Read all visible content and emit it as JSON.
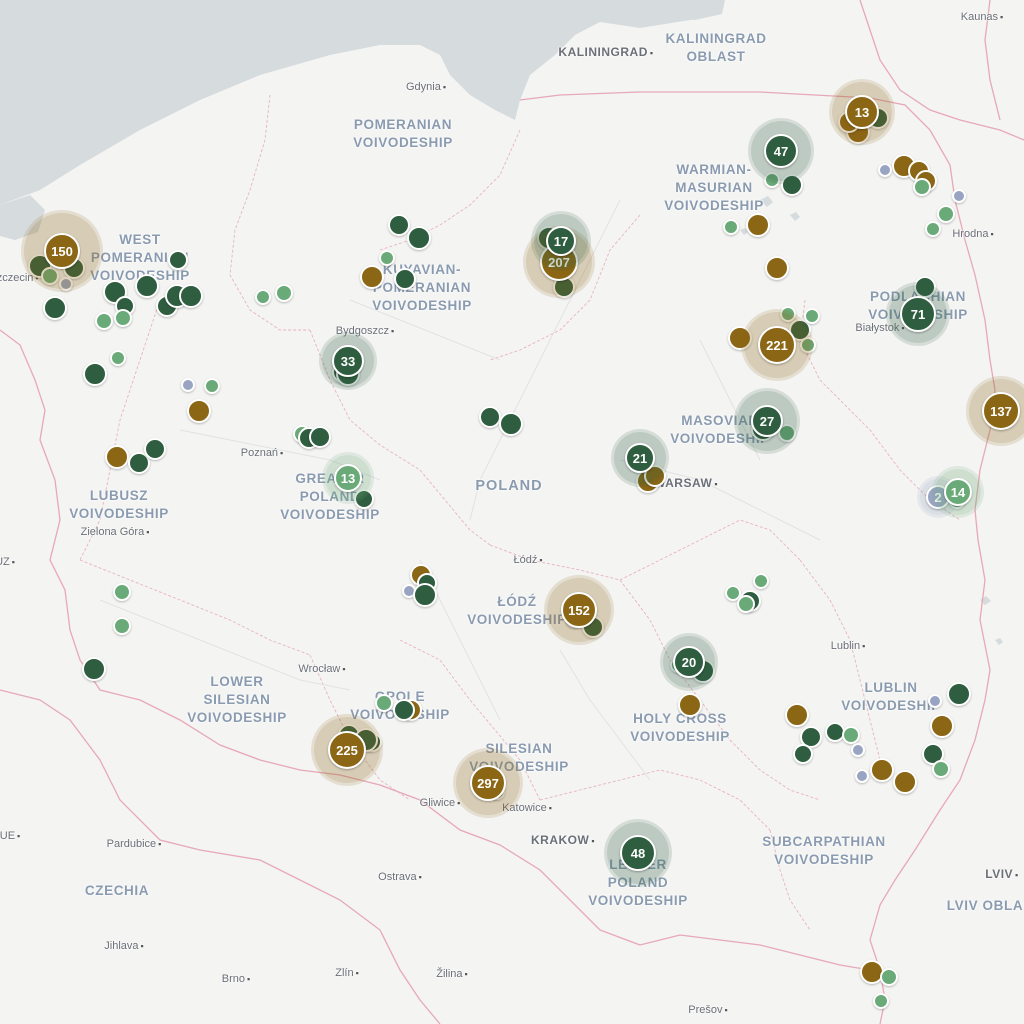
{
  "map": {
    "country_label": "POLAND",
    "colors": {
      "dark_green": "#2f5d3f",
      "light_green": "#6aaa78",
      "brown": "#8b6614",
      "grey_blue": "#98a4c2",
      "water": "#d6dbde",
      "land": "#f4f4f3"
    },
    "region_labels": [
      {
        "text": "KALININGRAD\nOBLAST"
      },
      {
        "text": "POMERANIAN\nVOIVODESHIP"
      },
      {
        "text": "WARMIAN-\nMASURIAN\nVOIVODESHIP"
      },
      {
        "text": "WEST\nPOMERANIAN\nVOIVODESHIP"
      },
      {
        "text": "KUYAVIAN-\nPOMERANIAN\nVOIVODESHIP"
      },
      {
        "text": "PODLACHIAN\nVOIVODESHIP"
      },
      {
        "text": "MASOVIAN\nVOIVODESHIP"
      },
      {
        "text": "GREATER\nPOLAND\nVOIVODESHIP"
      },
      {
        "text": "LUBUSZ\nVOIVODESHIP"
      },
      {
        "text": "ŁÓDŹ\nVOIVODESHIP"
      },
      {
        "text": "LOWER\nSILESIAN\nVOIVODESHIP"
      },
      {
        "text": "OPOLE\nVOIVODESHIP"
      },
      {
        "text": "SILESIAN\nVOIVODESHIP"
      },
      {
        "text": "HOLY CROSS\nVOIVODESHIP"
      },
      {
        "text": "LUBLIN\nVOIVODESHIP"
      },
      {
        "text": "LESSER\nPOLAND\nVOIVODESHIP"
      },
      {
        "text": "SUBCARPATHIAN\nVOIVODESHIP"
      },
      {
        "text": "CZECHIA"
      },
      {
        "text": "LVIV OBLA"
      }
    ],
    "city_labels": [
      {
        "text": "Kaunas"
      },
      {
        "text": "KALININGRAD"
      },
      {
        "text": "Gdynia"
      },
      {
        "text": "Hrodna"
      },
      {
        "text": "Białystok"
      },
      {
        "text": "Bydgoszcz"
      },
      {
        "text": "Poznań"
      },
      {
        "text": "WARSAW"
      },
      {
        "text": "Zielona Góra"
      },
      {
        "text": "Łódź"
      },
      {
        "text": "Lublin"
      },
      {
        "text": "Wrocław"
      },
      {
        "text": "Gliwice"
      },
      {
        "text": "Katowice"
      },
      {
        "text": "KRAKOW"
      },
      {
        "text": "Pardubice"
      },
      {
        "text": "Ostrava"
      },
      {
        "text": "Jihlava"
      },
      {
        "text": "Brno"
      },
      {
        "text": "Zlín"
      },
      {
        "text": "Žilina"
      },
      {
        "text": "Prešov"
      },
      {
        "text": "LVIV"
      },
      {
        "text": "Szczecin"
      },
      {
        "text": "UE"
      },
      {
        "text": "UZ"
      }
    ],
    "clusters": [
      {
        "count": "150",
        "color": "brown"
      },
      {
        "count": "207",
        "color": "brown"
      },
      {
        "count": "47",
        "color": "dark_green"
      },
      {
        "count": "221",
        "color": "brown"
      },
      {
        "count": "71",
        "color": "dark_green"
      },
      {
        "count": "137",
        "color": "brown"
      },
      {
        "count": "21",
        "color": "dark_green"
      },
      {
        "count": "13",
        "color": "light_green"
      },
      {
        "count": "2",
        "color": "grey_blue"
      },
      {
        "count": "152",
        "color": "brown"
      },
      {
        "count": "225",
        "color": "brown"
      },
      {
        "count": "297",
        "color": "brown"
      },
      {
        "count": "48",
        "color": "dark_green"
      },
      {
        "count": "13",
        "color": "brown"
      },
      {
        "count": "33",
        "color": "dark_green"
      },
      {
        "count": "27",
        "color": "dark_green"
      },
      {
        "count": "17",
        "color": "dark_green"
      },
      {
        "count": "14",
        "color": "light_green"
      },
      {
        "count": "20",
        "color": "dark_green"
      }
    ]
  }
}
